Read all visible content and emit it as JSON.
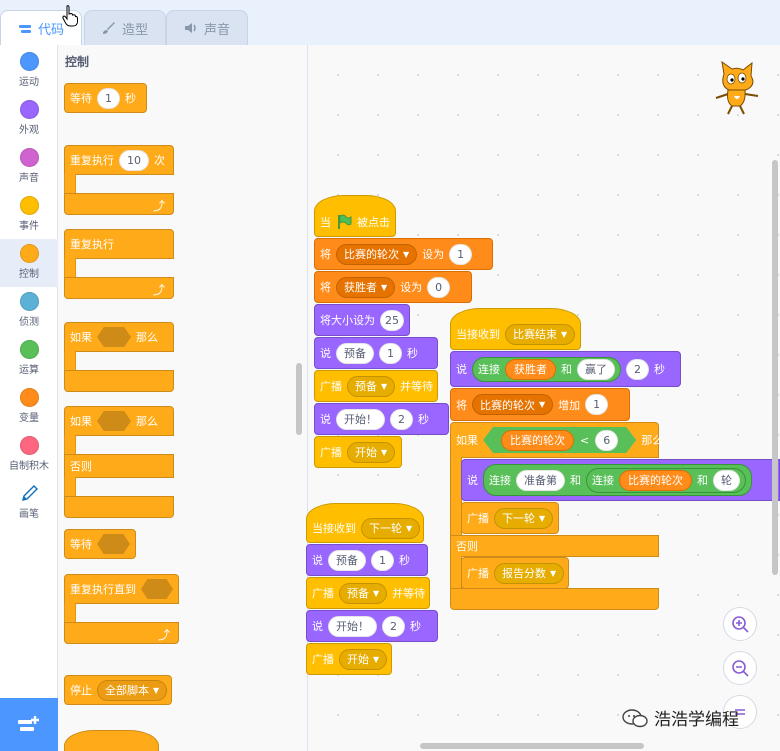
{
  "tabs": [
    {
      "label": "代码",
      "icon": "code-icon",
      "active": true
    },
    {
      "label": "造型",
      "icon": "brush-icon",
      "active": false
    },
    {
      "label": "声音",
      "icon": "speaker-icon",
      "active": false
    }
  ],
  "categories": [
    {
      "label": "运动",
      "color": "#4c97ff"
    },
    {
      "label": "外观",
      "color": "#9966ff"
    },
    {
      "label": "声音",
      "color": "#cf63cf"
    },
    {
      "label": "事件",
      "color": "#ffbf00"
    },
    {
      "label": "控制",
      "color": "#ffab19"
    },
    {
      "label": "侦测",
      "color": "#5cb1d6"
    },
    {
      "label": "运算",
      "color": "#59c059"
    },
    {
      "label": "变量",
      "color": "#ff8c1a"
    },
    {
      "label": "自制积木",
      "color": "#ff6680"
    },
    {
      "label": "画笔",
      "color": "#0fbd8c"
    }
  ],
  "palette": {
    "title": "控制",
    "wait": {
      "label": "等待",
      "value": "1",
      "unit": "秒"
    },
    "repeat": {
      "label": "重复执行",
      "value": "10",
      "unit": "次"
    },
    "forever": {
      "label": "重复执行"
    },
    "if_then": {
      "label": "如果",
      "then": "那么"
    },
    "if_else": {
      "label": "如果",
      "then": "那么",
      "else": "否则"
    },
    "wait_until": {
      "label": "等待"
    },
    "repeat_until": {
      "label": "重复执行直到"
    },
    "stop": {
      "label": "停止",
      "option": "全部脚本"
    }
  },
  "script1": {
    "hat": {
      "when": "当",
      "clicked": "被点击"
    },
    "set1": {
      "set": "将",
      "var": "比赛的轮次",
      "to": "设为",
      "value": "1"
    },
    "set2": {
      "set": "将",
      "var": "获胜者",
      "to": "设为",
      "value": "0"
    },
    "size": {
      "label": "将大小设为",
      "value": "25"
    },
    "say1": {
      "say": "说",
      "text": "预备",
      "secs": "1",
      "unit": "秒"
    },
    "bcast_wait": {
      "label": "广播",
      "msg": "预备",
      "wait": "并等待"
    },
    "say2": {
      "say": "说",
      "text": "开始！",
      "secs": "2",
      "unit": "秒"
    },
    "bcast": {
      "label": "广播",
      "msg": "开始"
    }
  },
  "script2": {
    "hat": {
      "label": "当接收到",
      "msg": "下一轮"
    },
    "say1": {
      "say": "说",
      "text": "预备",
      "secs": "1",
      "unit": "秒"
    },
    "bcast_wait": {
      "label": "广播",
      "msg": "预备",
      "wait": "并等待"
    },
    "say2": {
      "say": "说",
      "text": "开始！",
      "secs": "2",
      "unit": "秒"
    },
    "bcast": {
      "label": "广播",
      "msg": "开始"
    }
  },
  "script3": {
    "hat": {
      "label": "当接收到",
      "msg": "比赛结束"
    },
    "say1": {
      "say": "说",
      "join": "连接",
      "a": "获胜者",
      "and": "和",
      "b": "赢了",
      "secs": "2",
      "unit": "秒"
    },
    "change": {
      "set": "将",
      "var": "比赛的轮次",
      "by": "增加",
      "value": "1"
    },
    "if": {
      "label": "如果",
      "var": "比赛的轮次",
      "lt": "<",
      "value": "6",
      "then": "那么"
    },
    "say2": {
      "say": "说",
      "join1": "连接",
      "a": "准备第",
      "and1": "和",
      "join2": "连接",
      "var": "比赛的轮次",
      "and2": "和",
      "b": "轮"
    },
    "bcast1": {
      "label": "广播",
      "msg": "下一轮"
    },
    "else": "否则",
    "bcast2": {
      "label": "广播",
      "msg": "报告分数"
    }
  },
  "watermark": "浩浩学编程",
  "colors": {
    "accent": "#4c97ff",
    "control": "#ffab19",
    "event": "#ffbf00",
    "looks": "#9966ff",
    "variable": "#ff8c1a",
    "operator": "#59c059"
  }
}
